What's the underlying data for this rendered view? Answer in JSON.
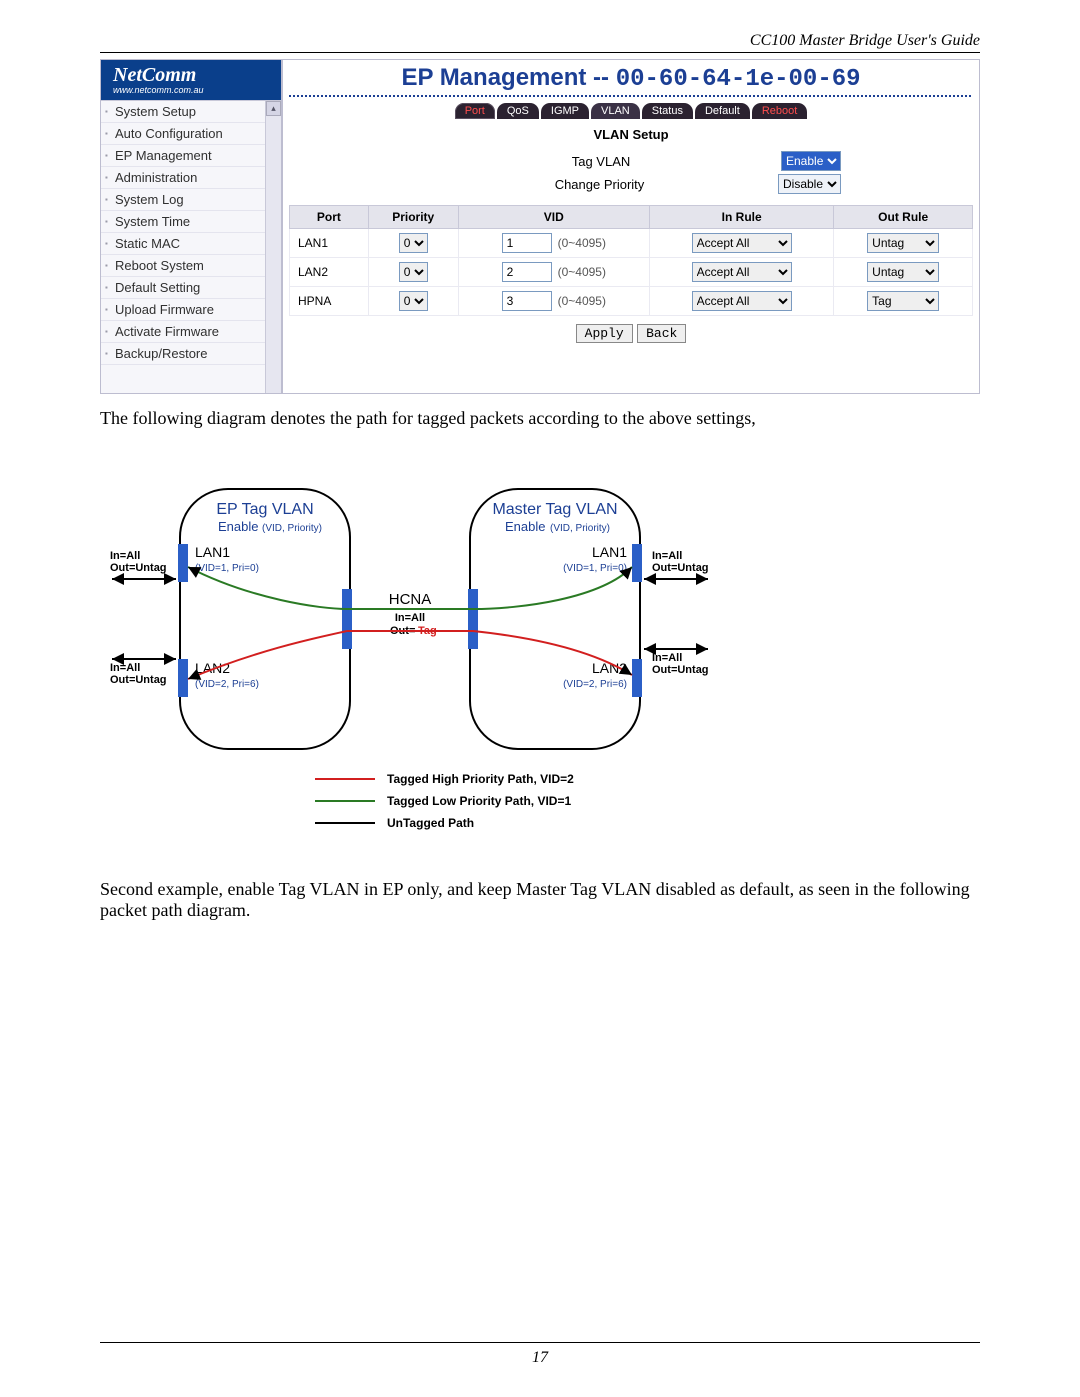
{
  "doc": {
    "header": "CC100 Master Bridge User's Guide",
    "page_number": "17",
    "para1": "The following diagram denotes the path for tagged packets according to the above settings,",
    "para2": "Second example, enable Tag VLAN in EP only, and keep Master Tag VLAN disabled as default, as seen in the following packet path diagram."
  },
  "sidebar": {
    "brand": "NetComm",
    "brand_sub": "www.netcomm.com.au",
    "items": [
      "System Setup",
      "Auto Configuration",
      "EP Management",
      "Administration",
      "System Log",
      "System Time",
      "Static MAC",
      "Reboot System",
      "Default Setting",
      "Upload Firmware",
      "Activate Firmware",
      "Backup/Restore"
    ]
  },
  "main": {
    "title_prefix": "EP Management -- ",
    "mac": "00-60-64-1e-00-69",
    "tabs": [
      "Port",
      "QoS",
      "IGMP",
      "VLAN",
      "Status",
      "Default",
      "Reboot"
    ],
    "section_title": "VLAN Setup",
    "tag_vlan_label": "Tag VLAN",
    "tag_vlan_value": "Enable",
    "change_priority_label": "Change Priority",
    "change_priority_value": "Disable",
    "table": {
      "headers": [
        "Port",
        "Priority",
        "VID",
        "In Rule",
        "Out Rule"
      ],
      "vid_range": "(0~4095)",
      "rows": [
        {
          "port": "LAN1",
          "priority": "0",
          "vid": "1",
          "in_rule": "Accept All",
          "out_rule": "Untag"
        },
        {
          "port": "LAN2",
          "priority": "0",
          "vid": "2",
          "in_rule": "Accept All",
          "out_rule": "Untag"
        },
        {
          "port": "HPNA",
          "priority": "0",
          "vid": "3",
          "in_rule": "Accept All",
          "out_rule": "Tag"
        }
      ]
    },
    "apply_label": "Apply",
    "back_label": "Back"
  },
  "diagram": {
    "left_title": "EP Tag VLAN",
    "left_sub": "Enable",
    "left_sub2": "(VID, Priority)",
    "right_title": "Master Tag VLAN",
    "right_sub": "Enable",
    "right_sub2": "(VID, Priority)",
    "lan1": "LAN1",
    "lan2": "LAN2",
    "lan1_vid": "(VID=1, Pri=0)",
    "lan2_vid": "(VID=2, Pri=6)",
    "hcna": "HCNA",
    "hcna_in": "In=All",
    "hcna_out": "Out=Tag",
    "in_all": "In=All",
    "out_untag": "Out=Untag",
    "legend": {
      "red": "Tagged High Priority Path, VID=2",
      "green": "Tagged Low Priority Path, VID=1",
      "black": "UnTagged Path"
    }
  }
}
